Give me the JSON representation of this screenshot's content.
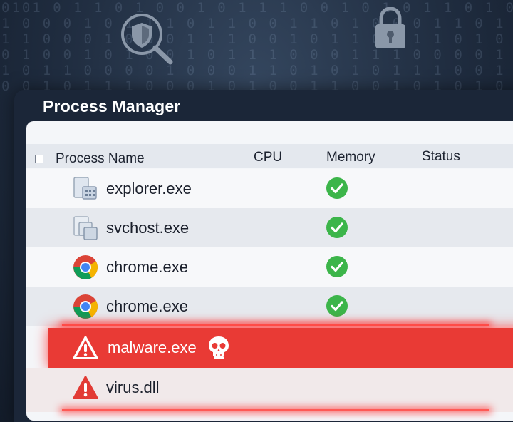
{
  "background": {
    "binary_lines": [
      "0101 0 1 1 0 1 0 0 1 0 1 1 1 0 0 1 0 1 0 1 1 0 1 0 0 1 0 1 1 0 1",
      "1 0 0 0 1 0 1 1 1 0 1 1 0 0 1 1 0 1 0 0 0 1 1 0 1 0 1 0 1 1 0 0",
      "1 1 0 0 0 1 0 0 0 1 1 1 0 0 1 0 1 1 0 0 1 1 0 1 0 0 1 0 1 0 0 1",
      "0 1 0 0 1 0 1 0 0 1 0 1 1 1 0 0 0 1 1 1 0 0 0 0 1 0 1 0 1 0 1 1",
      "1 0 1 1 0 0 0 0 1 0 0 0 1 1 0 1 0 1 0 1 1 1 0 0 1 1 0 1 0 0 0 1",
      "0 0 1 0 1 1 1 0 0 0 1 0 1 0 0 1 1 0 0 1 0 1 0 1 0 0 1 1 1 0 1 0"
    ],
    "top_icons": [
      "shield-search-icon",
      "padlock-icon"
    ]
  },
  "window": {
    "title": "Process Manager"
  },
  "table": {
    "columns": [
      "Process Name",
      "CPU",
      "Memory",
      "Status"
    ],
    "rows": [
      {
        "name": "explorer.exe",
        "icon": "explorer-window-icon",
        "memory_ok": true,
        "state": "normal"
      },
      {
        "name": "svchost.exe",
        "icon": "svchost-windows-icon",
        "memory_ok": true,
        "state": "normal"
      },
      {
        "name": "chrome.exe",
        "icon": "chrome-icon",
        "memory_ok": true,
        "state": "normal"
      },
      {
        "name": "chrome.exe",
        "icon": "chrome-icon",
        "memory_ok": true,
        "state": "normal"
      },
      {
        "name": "malware.exe",
        "icon": "warning-triangle-icon",
        "extra_icon": "skull-icon",
        "state": "threat"
      },
      {
        "name": "virus.dll",
        "icon": "warning-triangle-icon",
        "state": "threat"
      }
    ]
  },
  "colors": {
    "threat": "#e93a35",
    "ok_check": "#3cb54a",
    "window": "#1b2638"
  }
}
